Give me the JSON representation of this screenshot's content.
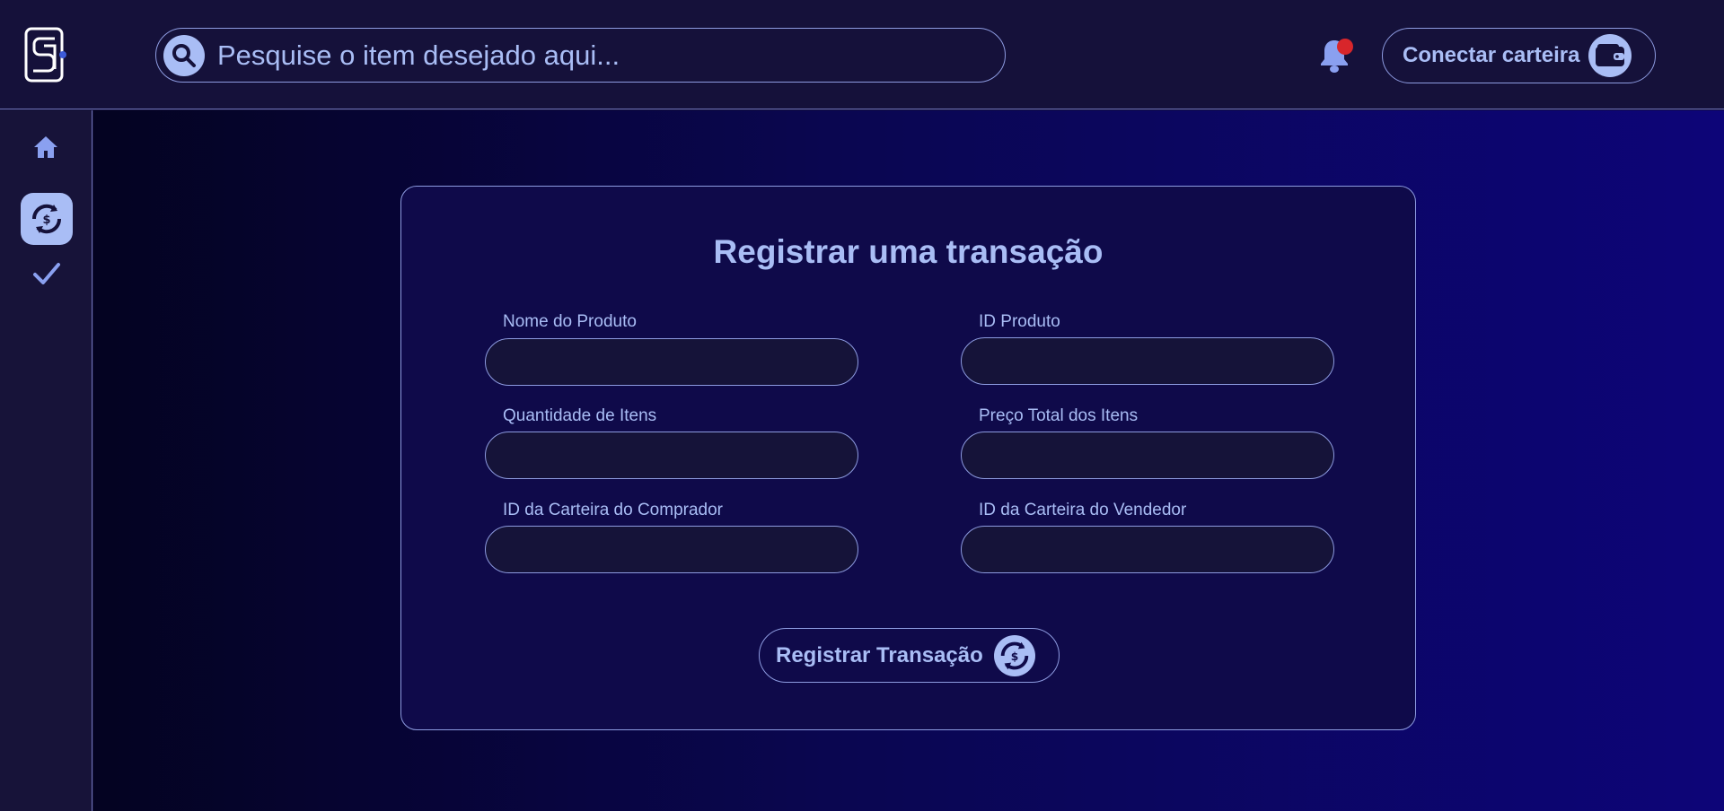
{
  "header": {
    "search": {
      "placeholder": "Pesquise o item desejado aqui...",
      "value": ""
    },
    "notification": {
      "has_unread": true
    },
    "connect_wallet_label": "Conectar carteira"
  },
  "sidebar": {
    "items": [
      {
        "name": "home",
        "icon": "home-icon",
        "active": false
      },
      {
        "name": "transactions",
        "icon": "transaction-icon",
        "active": true
      },
      {
        "name": "verify",
        "icon": "check-icon",
        "active": false
      }
    ]
  },
  "form": {
    "title": "Registrar uma transação",
    "fields": [
      {
        "label": "Nome do Produto",
        "value": ""
      },
      {
        "label": "ID Produto",
        "value": ""
      },
      {
        "label": "Quantidade de Itens",
        "value": ""
      },
      {
        "label": "Preço Total dos Itens",
        "value": ""
      },
      {
        "label": "ID da Carteira do Comprador",
        "value": ""
      },
      {
        "label": "ID da Carteira do Vendedor",
        "value": ""
      }
    ],
    "submit_label": "Registrar Transação"
  },
  "colors": {
    "accent": "#a9bdf5",
    "border": "#8d9be0",
    "notification_dot": "#d8262b",
    "header_bg": "#15113a"
  }
}
